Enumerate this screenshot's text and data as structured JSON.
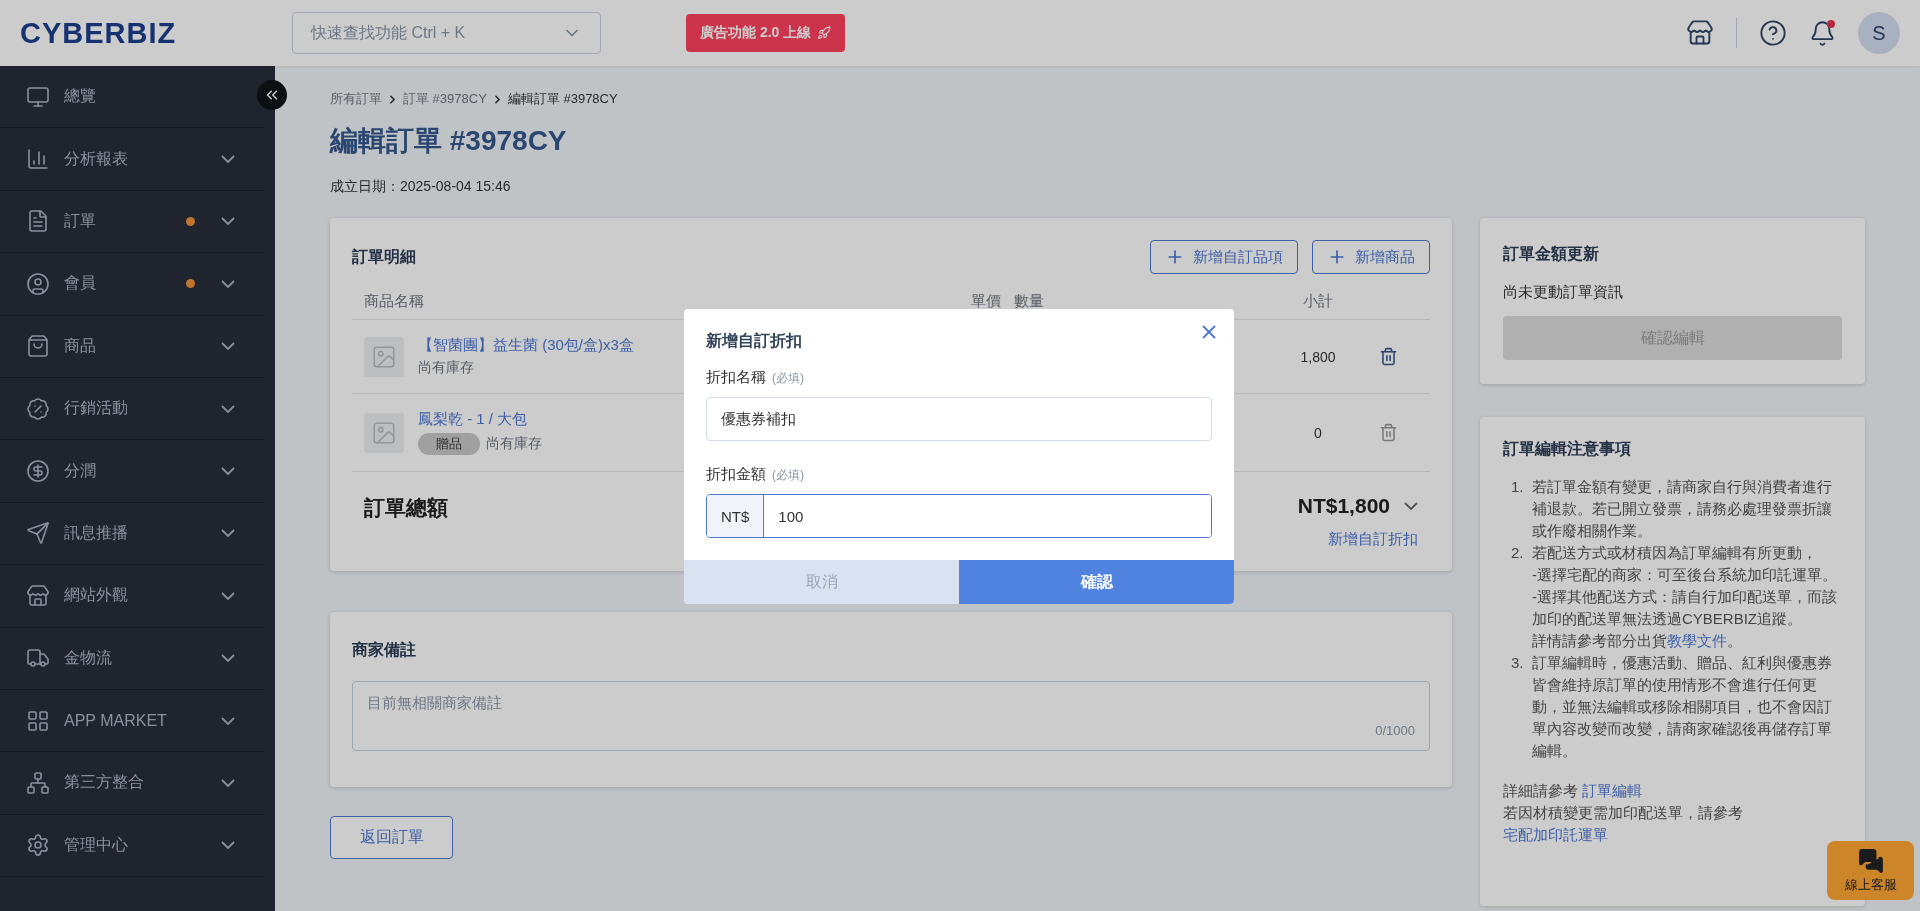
{
  "topbar": {
    "logo": "CYBERBIZ",
    "search": {
      "placeholder": "快速查找功能 Ctrl + K"
    },
    "promo": "廣告功能 2.0 上線",
    "avatar": "S",
    "bell_alert": true
  },
  "sidebar": {
    "items": [
      {
        "label": "總覽",
        "expandable": false,
        "notification": false
      },
      {
        "label": "分析報表",
        "expandable": true,
        "notification": false
      },
      {
        "label": "訂單",
        "expandable": true,
        "notification": true
      },
      {
        "label": "會員",
        "expandable": true,
        "notification": true
      },
      {
        "label": "商品",
        "expandable": true,
        "notification": false
      },
      {
        "label": "行銷活動",
        "expandable": true,
        "notification": false
      },
      {
        "label": "分潤",
        "expandable": true,
        "notification": false
      },
      {
        "label": "訊息推播",
        "expandable": true,
        "notification": false
      },
      {
        "label": "網站外觀",
        "expandable": true,
        "notification": false
      },
      {
        "label": "金物流",
        "expandable": true,
        "notification": false
      },
      {
        "label": "APP MARKET",
        "expandable": true,
        "notification": false
      },
      {
        "label": "第三方整合",
        "expandable": true,
        "notification": false
      },
      {
        "label": "管理中心",
        "expandable": true,
        "notification": false
      }
    ]
  },
  "breadcrumb": [
    {
      "label": "所有訂單",
      "current": false
    },
    {
      "label": "訂單 #3978CY",
      "current": false
    },
    {
      "label": "編輯訂單 #3978CY",
      "current": true
    }
  ],
  "page_title": "編輯訂單 #3978CY",
  "created": "成立日期：2025-08-04 15:46",
  "order_details": {
    "title": "訂單明細",
    "buttons": [
      "新增自訂品項",
      "新增商品"
    ],
    "columns": [
      "商品名稱",
      "單價",
      "數量",
      "小計"
    ],
    "rows": [
      {
        "name": "【智菌團】益生菌 (30包/盒)x3盒",
        "stock": "尚有庫存",
        "subtotal": "1,800",
        "deletable": true
      },
      {
        "name": "鳳梨乾 - 1 / 大包",
        "tag": "贈品",
        "stock": "尚有庫存",
        "subtotal": "0",
        "deletable": false
      }
    ],
    "total_label": "訂單總額",
    "total": "NT$1,800",
    "add_discount": "新增自訂折扣"
  },
  "merchant_note": {
    "title": "商家備註",
    "placeholder": "目前無相關商家備註",
    "count": "0/1000"
  },
  "back_button": "返回訂單",
  "amount_update": {
    "title": "訂單金額更新",
    "status": "尚未更動訂單資訊",
    "button": "確認編輯",
    "disabled": true
  },
  "notes": {
    "title": "訂單編輯注意事項",
    "items": [
      {
        "marker": "1.",
        "lines": [
          {
            "text": "若訂單金額有變更，請商家自行與消費者進行補退款。若已開立發票，請務必處理發票折讓或作廢相關作業。"
          }
        ]
      },
      {
        "marker": "2.",
        "lines": [
          {
            "text": "若配送方式或材積因為訂單編輯有所更動，"
          },
          {
            "text": "-選擇宅配的商家：可至後台系統加印託運單。"
          },
          {
            "text": "-選擇其他配送方式：請自行加印配送單，而該加印的配送單無法透過CYBERBIZ追蹤。"
          },
          {
            "text": "詳情請參考部分出貨",
            "link": "教學文件",
            "after": "。"
          }
        ]
      },
      {
        "marker": "3.",
        "lines": [
          {
            "text": "訂單編輯時，優惠活動、贈品、紅利與優惠券皆會維持原訂單的使用情形不會進行任何更動，並無法編輯或移除相關項目，也不會因訂單內容改變而改變，請商家確認後再儲存訂單編輯。"
          }
        ]
      }
    ],
    "footer": [
      {
        "text": "詳細請參考 ",
        "link": "訂單編輯"
      },
      {
        "text": "若因材積變更需加印配送單，請參考 ",
        "link": "宅配加印託運單"
      }
    ]
  },
  "chat_button": "線上客服",
  "modal": {
    "title": "新增自訂折扣",
    "fields": [
      {
        "label": "折扣名稱",
        "required": "(必填)",
        "value": "優惠券補扣",
        "focused": false
      },
      {
        "label": "折扣金額",
        "required": "(必填)",
        "prefix": "NT$",
        "value": "100",
        "focused": true
      }
    ],
    "buttons": [
      {
        "label": "取消",
        "primary": false
      },
      {
        "label": "確認",
        "primary": true
      }
    ]
  }
}
